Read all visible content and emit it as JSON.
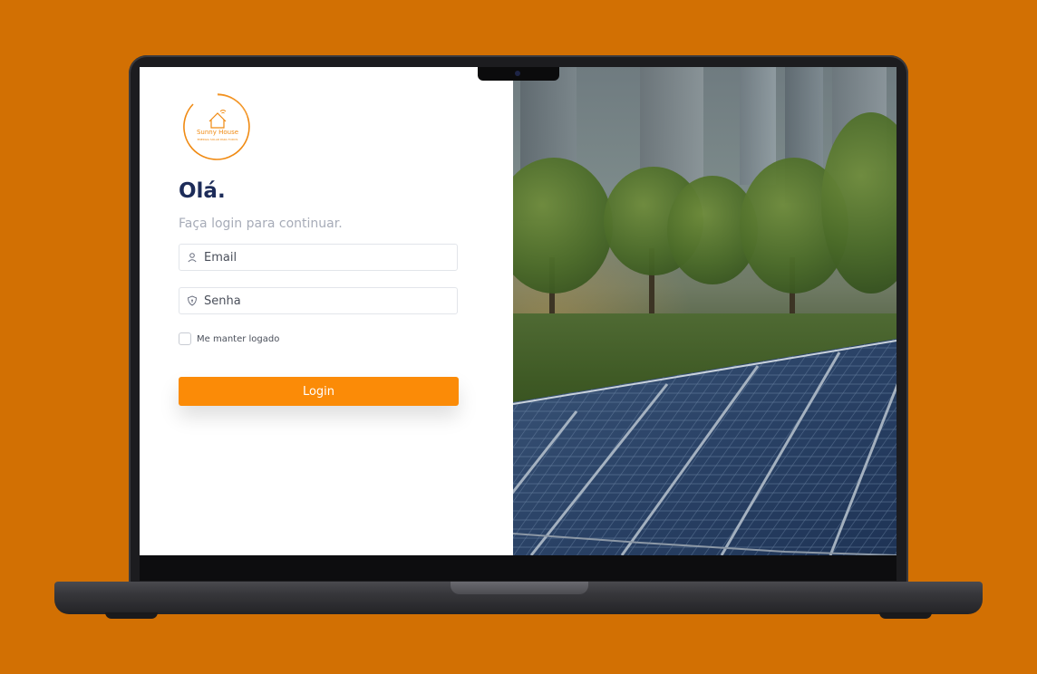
{
  "logo": {
    "brand": "Sunny House",
    "tagline": "ENERGIA SOLAR PARA TODOS",
    "icon": "house-wifi-icon"
  },
  "login": {
    "title": "Olá.",
    "subtitle": "Faça login para continuar.",
    "email_placeholder": "Email",
    "password_placeholder": "Senha",
    "remember_label": "Me manter logado",
    "remember_checked": false,
    "submit_label": "Login"
  },
  "icons": {
    "email": "user-icon",
    "password": "shield-icon"
  },
  "colors": {
    "background": "#d27003",
    "accent": "#fb8b07",
    "title": "#1d2c59",
    "subtitle": "#a7acb8"
  }
}
